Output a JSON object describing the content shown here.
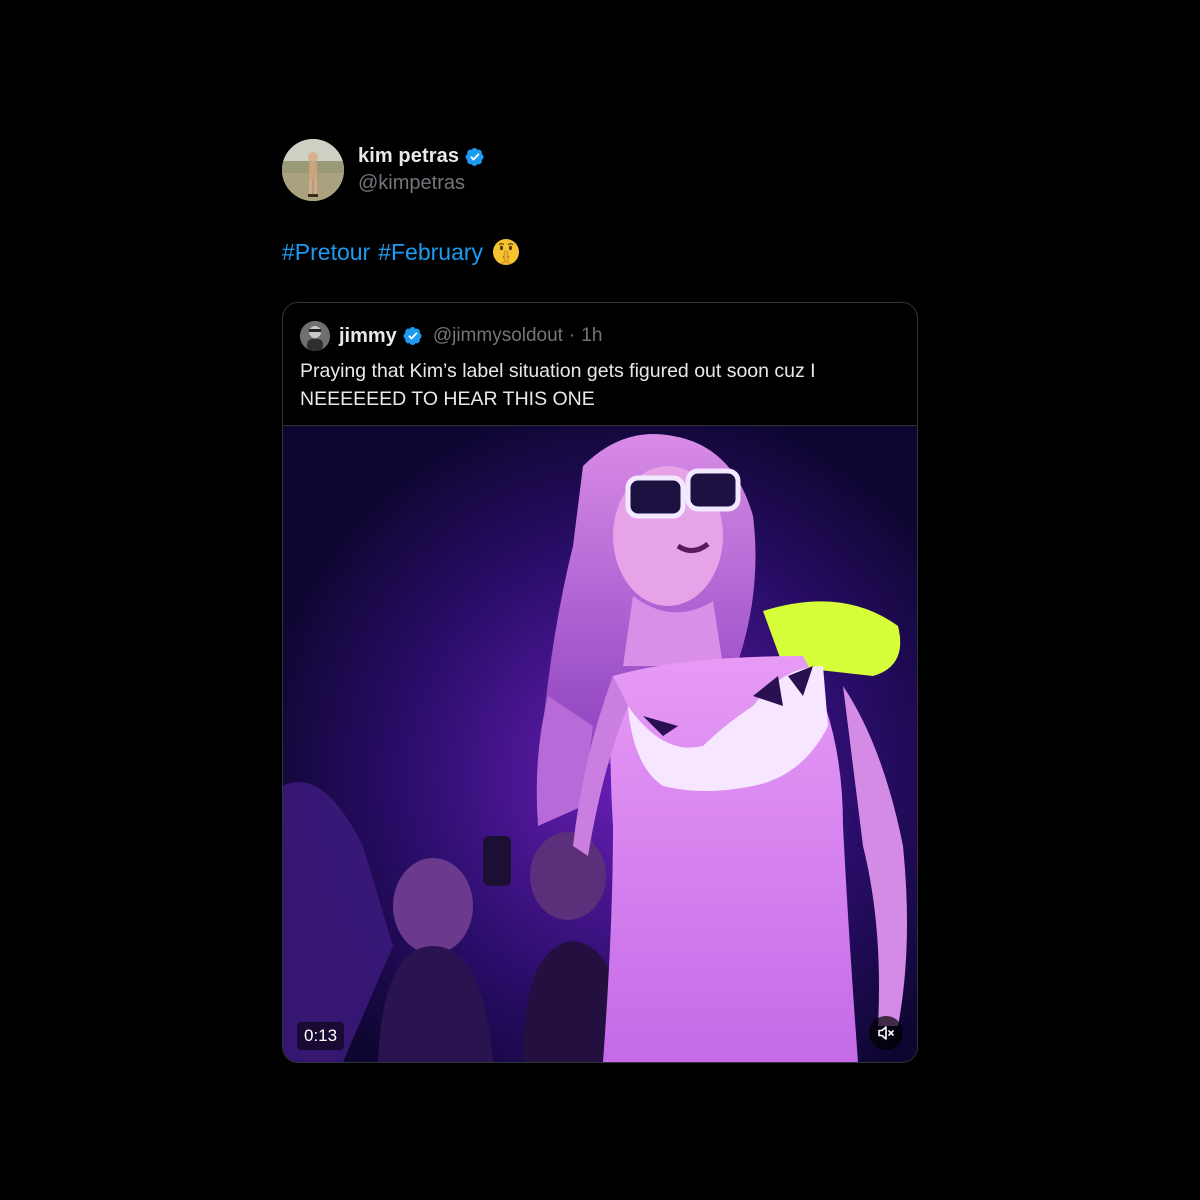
{
  "post": {
    "author": {
      "display_name": "kim petras",
      "handle": "@kimpetras",
      "verified": true,
      "avatar_icon": "profile-photo"
    },
    "text": {
      "hashtags": [
        "#Pretour",
        "#February"
      ],
      "emoji": "shushing-face-emoji"
    },
    "quoted_post": {
      "author": {
        "display_name": "jimmy",
        "handle": "@jimmysoldout",
        "verified": true
      },
      "separator": "·",
      "time": "1h",
      "text": "Praying that Kim’s label situation gets figured out soon cuz I NEEEEEED TO HEAR THIS ONE",
      "media": {
        "type": "video",
        "duration": "0:13",
        "muted_icon": "speaker-muted-icon"
      }
    }
  },
  "colors": {
    "background": "#000000",
    "text_primary": "#e7e9ea",
    "text_secondary": "#71767b",
    "accent": "#1d9bf0",
    "border": "#2f3336"
  }
}
